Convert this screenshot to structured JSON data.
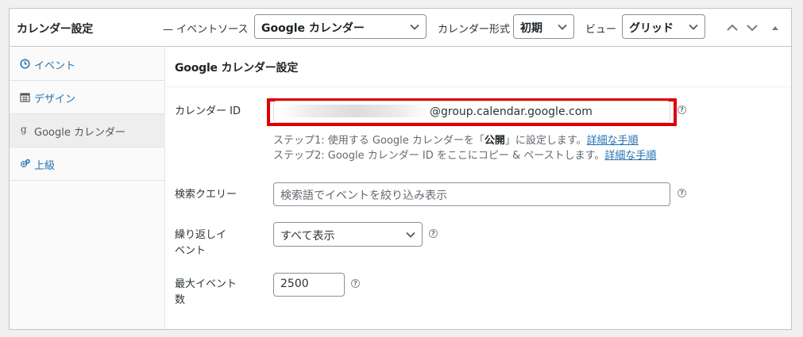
{
  "header": {
    "title": "カレンダー設定",
    "event_source_label": "— イベントソース",
    "event_source_value": "Google カレンダー",
    "calendar_format_label": "カレンダー形式",
    "calendar_format_value": "初期",
    "view_label": "ビュー",
    "view_value": "グリッド"
  },
  "sidebar": {
    "items": [
      {
        "label": "イベント",
        "icon": "clock-icon"
      },
      {
        "label": "デザイン",
        "icon": "calendar-icon"
      },
      {
        "label": "Google カレンダー",
        "icon": "google-icon",
        "active": true
      },
      {
        "label": "上級",
        "icon": "gears-icon"
      }
    ]
  },
  "main": {
    "section_title": "Google カレンダー設定",
    "calendar_id": {
      "label": "カレンダー ID",
      "value_suffix": "@group.calendar.google.com",
      "step1_prefix": "ステップ1: 使用する Google カレンダーを「",
      "step1_bold": "公開",
      "step1_suffix": "」に設定します。",
      "step1_link": "詳細な手順",
      "step2_text": "ステップ2: Google カレンダー ID をここにコピー & ペーストします。",
      "step2_link": "詳細な手順"
    },
    "search_query": {
      "label": "検索クエリー",
      "placeholder": "検索語でイベントを絞り込み表示"
    },
    "recurring": {
      "label_line1": "繰り返しイ",
      "label_line2": "ベント",
      "value": "すべて表示"
    },
    "max_events": {
      "label_line1": "最大イベント",
      "label_line2": "数",
      "value": "2500"
    },
    "help_glyph": "?"
  }
}
